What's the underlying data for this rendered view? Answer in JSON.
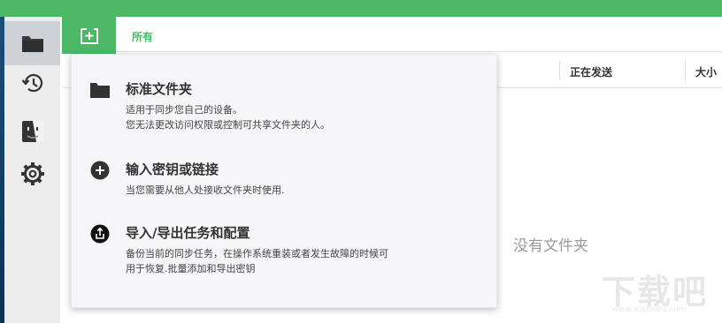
{
  "sidebar": {
    "items": [
      {
        "icon": "folder-icon",
        "active": true
      },
      {
        "icon": "history-icon",
        "active": false
      },
      {
        "icon": "finder-icon",
        "active": false
      },
      {
        "icon": "gear-icon",
        "active": false
      }
    ]
  },
  "toolbar": {
    "add_icon": "add-folder-icon",
    "tab_all": "所有"
  },
  "columns": {
    "sending": "正在发送",
    "size": "大小"
  },
  "empty_message": "没有文件夹",
  "menu": {
    "items": [
      {
        "icon": "folder-icon",
        "title": "标准文件夹",
        "desc_line1": "适用于同步您自己的设备。",
        "desc_line2": "您无法更改访问权限或控制可共享文件夹的人。"
      },
      {
        "icon": "plus-circle-icon",
        "title": "输入密钥或链接",
        "desc_line1": "当您需要从他人处接收文件夹时使用."
      },
      {
        "icon": "share-icon",
        "title": "导入/导出任务和配置",
        "desc_line1": "备份当前的同步任务，在操作系统重装或者发生故障的时候可",
        "desc_line2": "用于恢复.批量添加和导出密钥"
      }
    ]
  },
  "watermark": {
    "text": "下载吧",
    "url": "www.xiazaiba.com"
  },
  "colors": {
    "accent": "#4cb866",
    "sidebar_bg": "#ededed",
    "menu_bg": "#f6f6f8"
  }
}
